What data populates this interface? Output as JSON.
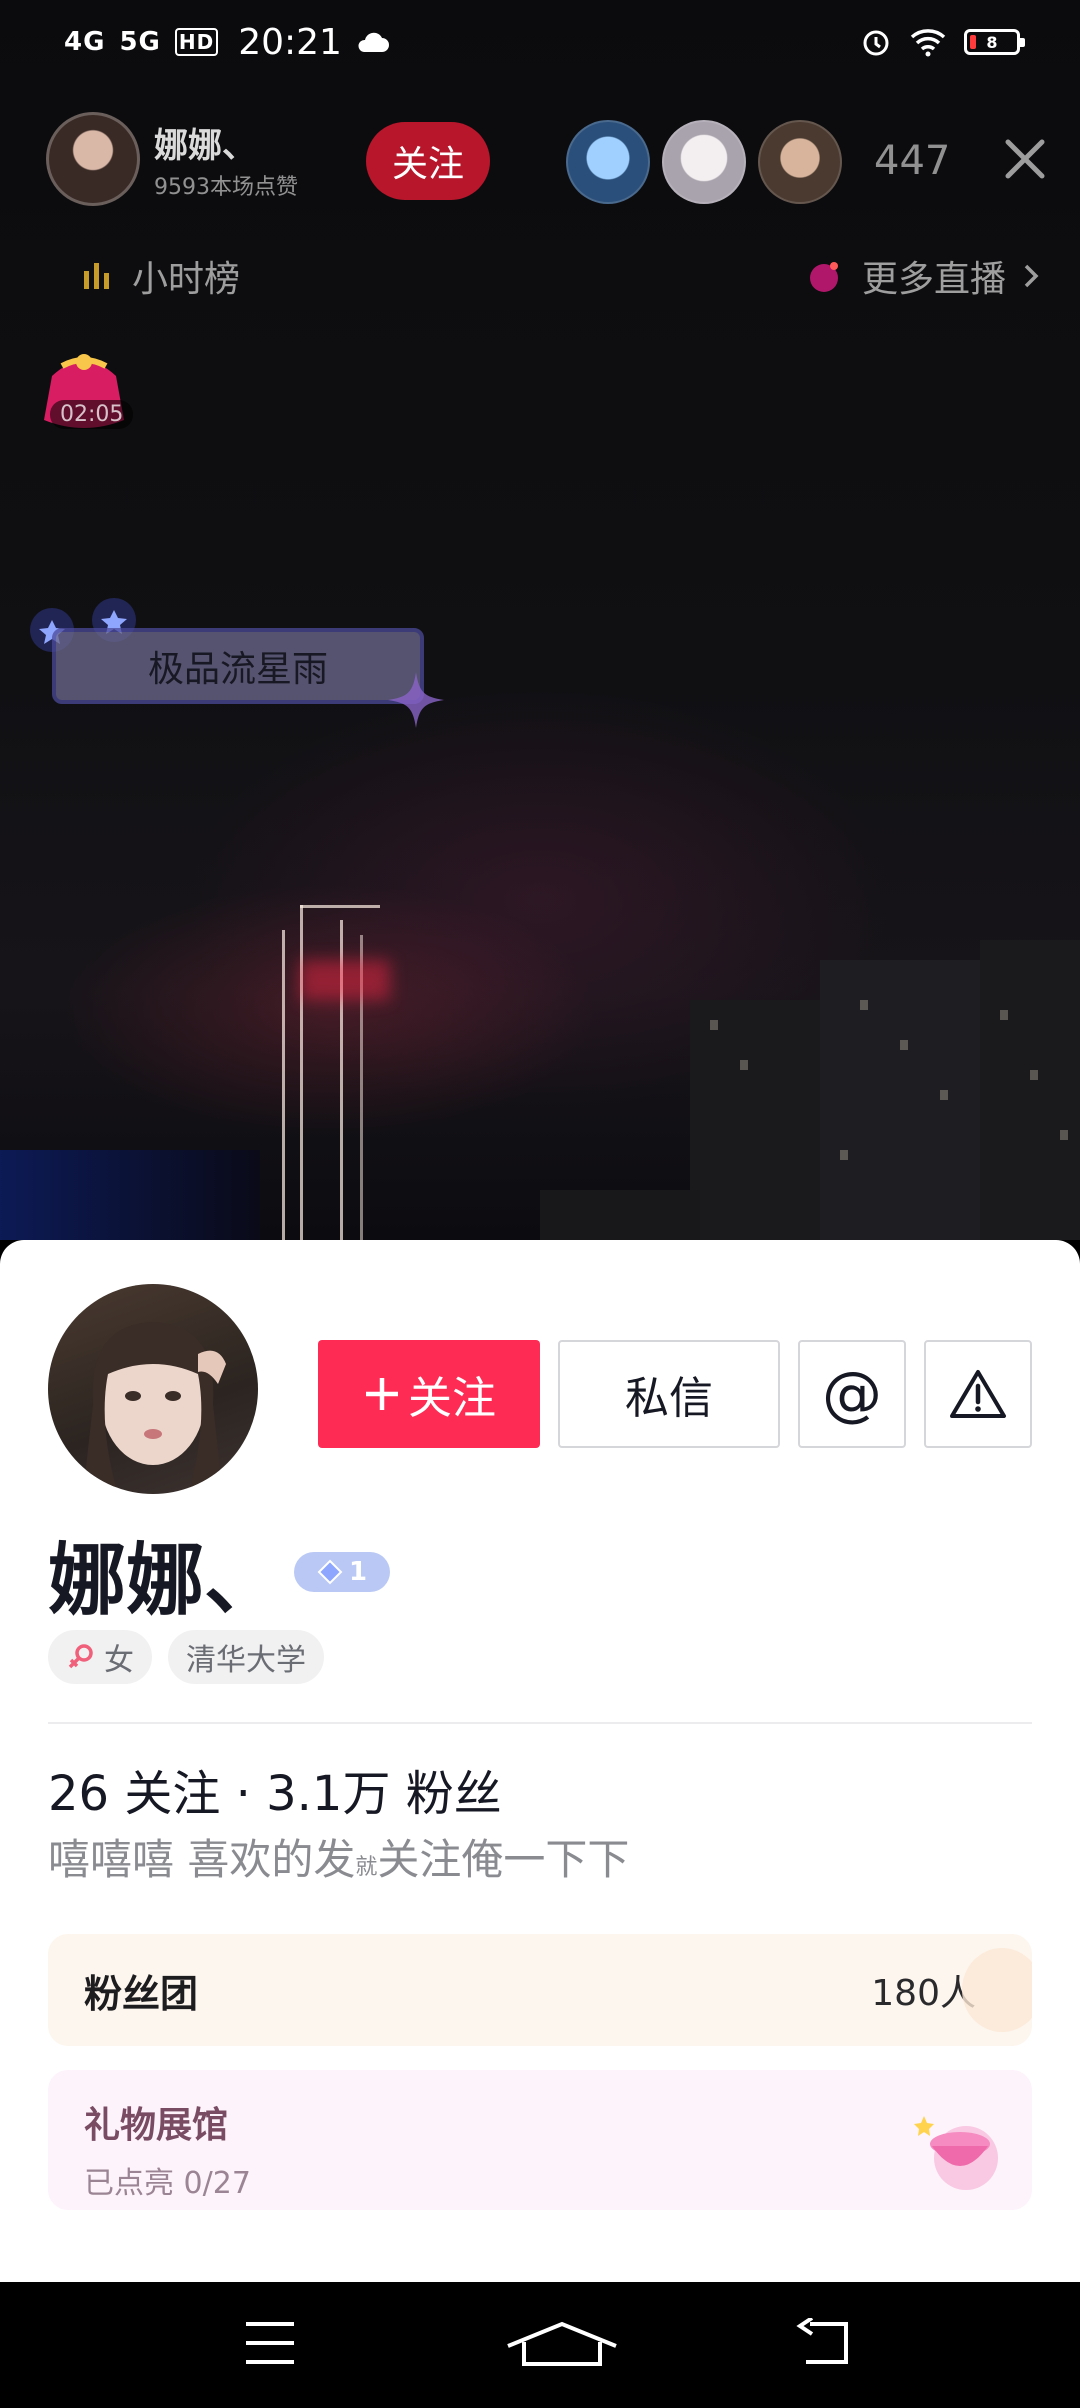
{
  "status_bar": {
    "network1": "4G",
    "network2": "5G",
    "hd": "HD",
    "time": "20:21",
    "battery": "8"
  },
  "live_header": {
    "host_name": "娜娜、",
    "host_likes": "9593本场点赞",
    "follow_label": "关注",
    "viewer_count": "447",
    "hour_rank_label": "小时榜",
    "more_live_label": "更多直播"
  },
  "gift_timer": "02:05",
  "meteor_banner": "极品流星雨",
  "profile": {
    "follow_label": "关注",
    "message_label": "私信",
    "at_label": "@",
    "name": "娜娜、",
    "level": "1",
    "tags": [
      "女",
      "清华大学"
    ],
    "stats": "26 关注 · 3.1万 粉丝",
    "bio_part1": "嘻嘻嘻 喜欢的发",
    "bio_small": "就",
    "bio_part2": "关注俺一下下"
  },
  "fan_club": {
    "title": "粉丝团",
    "count": "180人"
  },
  "gift_gallery": {
    "title": "礼物展馆",
    "subtitle": "已点亮 0/27"
  },
  "colors": {
    "accent": "#fe2c55",
    "top_follow": "#b8162b",
    "level_badge": "#b9c8f5"
  }
}
